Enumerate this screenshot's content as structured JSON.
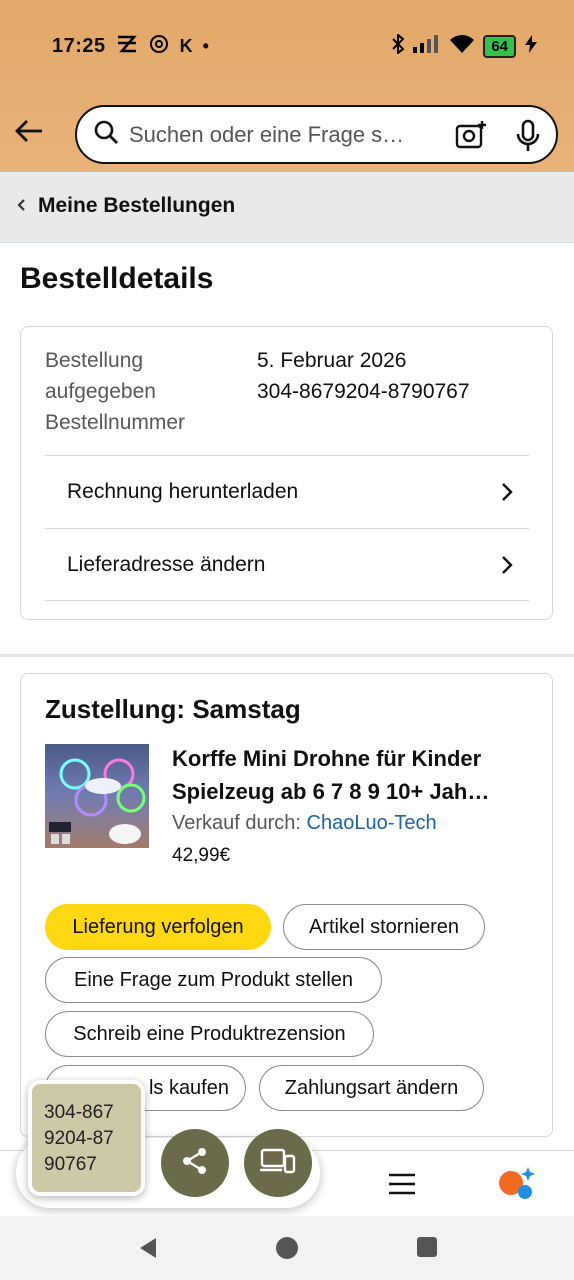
{
  "status_bar": {
    "time": "17:25",
    "carrier_k": "K",
    "battery": "64"
  },
  "search": {
    "placeholder": "Suchen oder eine Frage s…"
  },
  "breadcrumb": {
    "label": "Meine Bestellungen"
  },
  "page_title": "Bestelldetails",
  "order": {
    "label_placed_line1": "Bestellung",
    "label_placed_line2": "aufgegeben",
    "label_number": "Bestellnummer",
    "date": "5. Februar 2026",
    "number": "304-8679204-8790767",
    "links": [
      "Rechnung herunterladen",
      "Lieferadresse ändern"
    ]
  },
  "delivery": {
    "heading": "Zustellung: Samstag",
    "product_title_line1": "Korffe Mini Drohne für Kinder",
    "product_title_line2": "Spielzeug ab 6 7 8 9 10+ Jah…",
    "seller_prefix": "Verkauf durch: ",
    "seller_name": "ChaoLuo-Tech",
    "price": "42,99€",
    "actions": {
      "track": "Lieferung verfolgen",
      "cancel": "Artikel stornieren",
      "question": "Eine Frage zum Produkt stellen",
      "review": "Schreib eine Produktrezension",
      "buy_again": "Erneut kaufen",
      "buy_again_visible": "ls kaufen",
      "payment": "Zahlungsart ändern"
    }
  },
  "floating": {
    "note_line1": "304-867",
    "note_line2": "9204-87",
    "note_line3": "90767"
  },
  "colors": {
    "header": "#e8b27a",
    "primary_button": "#ffd814",
    "link": "#2162a1",
    "fab": "#6b6a4a"
  }
}
